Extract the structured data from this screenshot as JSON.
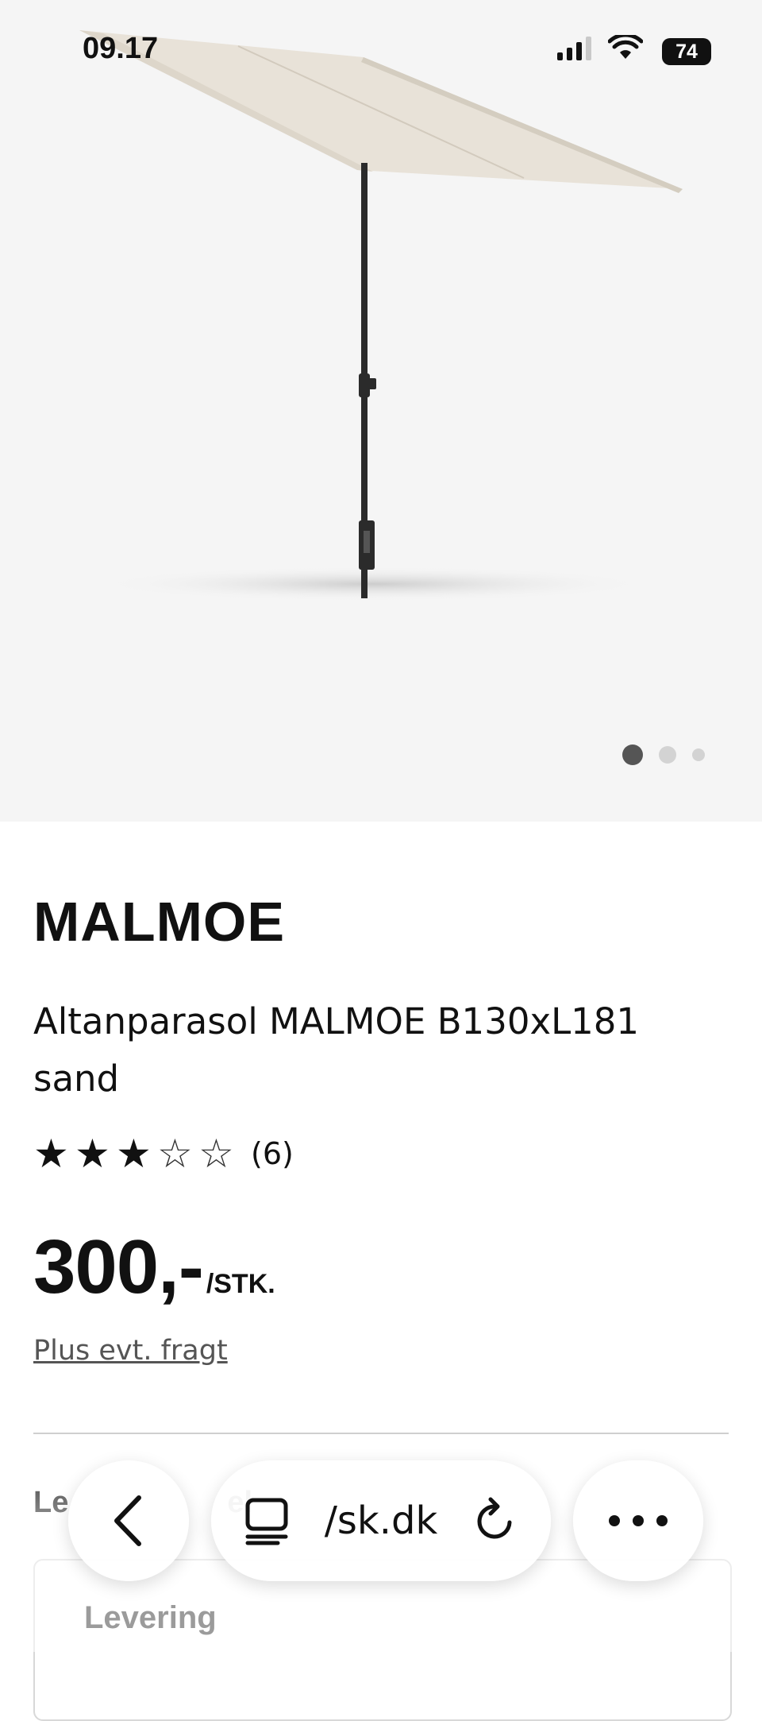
{
  "status_bar": {
    "time": "09.17",
    "battery": "74"
  },
  "product_image": {
    "description_icon": "balcony-parasol-image",
    "carousel": {
      "count": 3,
      "active_index": 0
    }
  },
  "product": {
    "brand": "MALMOE",
    "description": "Altanparasol MALMOE B130xL181 sand",
    "rating": {
      "stars": 3,
      "max": 5,
      "count_label": "(6)"
    },
    "price": "300,-",
    "unit": "/STK.",
    "shipping_link": "Plus evt. fragt"
  },
  "delivery": {
    "question_fragment": "Le",
    "question_fragment_2": "el",
    "label": "Levering"
  },
  "browser_toolbar": {
    "back_icon": "chevron-left-icon",
    "tabs_icon": "tabs-icon",
    "url": "/sk.dk",
    "reload_icon": "reload-icon",
    "more_icon": "more-icon"
  },
  "colors": {
    "hero_bg": "#f5f5f5",
    "text": "#111111",
    "link": "#555555",
    "divider": "#cfcfcf"
  }
}
